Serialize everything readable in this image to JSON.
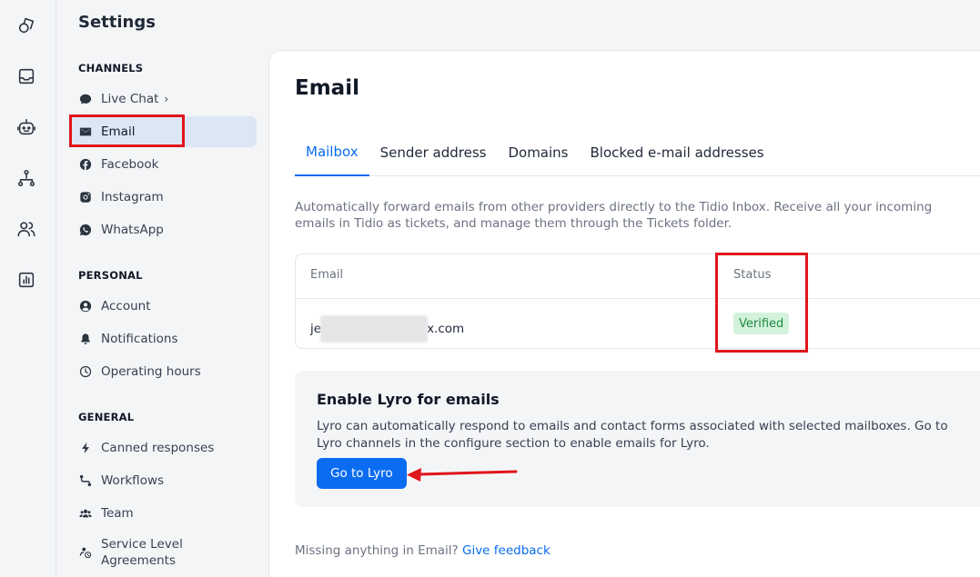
{
  "sidebar": {
    "title": "Settings",
    "sections": {
      "channels": "CHANNELS",
      "personal": "PERSONAL",
      "general": "GENERAL"
    },
    "items": {
      "live_chat": "Live Chat",
      "email": "Email",
      "facebook": "Facebook",
      "instagram": "Instagram",
      "whatsapp": "WhatsApp",
      "account": "Account",
      "notifications": "Notifications",
      "operating_hours": "Operating hours",
      "canned_responses": "Canned responses",
      "workflows": "Workflows",
      "team": "Team",
      "sla_line1": "Service Level",
      "sla_line2": "Agreements"
    }
  },
  "main": {
    "title": "Email",
    "tabs": [
      "Mailbox",
      "Sender address",
      "Domains",
      "Blocked e-mail addresses"
    ],
    "active_tab": "Mailbox",
    "description": "Automatically forward emails from other providers directly to the Tidio Inbox. Receive all your incoming emails in Tidio as tickets, and manage them through the Tickets folder.",
    "table": {
      "headers": {
        "email": "Email",
        "status": "Status"
      },
      "rows": [
        {
          "email_prefix": "je",
          "email_suffix": "x.com",
          "status": "Verified"
        }
      ]
    },
    "lyro": {
      "title": "Enable Lyro for emails",
      "description": "Lyro can automatically respond to emails and contact forms associated with selected mailboxes. Go to Lyro channels in the configure section to enable emails for Lyro.",
      "button": "Go to Lyro"
    },
    "footer": {
      "text": "Missing anything in Email?",
      "link": "Give feedback"
    }
  },
  "colors": {
    "accent": "#0a6cf0",
    "verified_bg": "#d3f2dc",
    "verified_text": "#1f8a43",
    "annotation_red": "#e0151b",
    "active_item_bg": "#dde6f5"
  },
  "icons": {
    "rail": [
      "shapes-icon",
      "inbox-icon",
      "bot-icon",
      "flow-icon",
      "users-icon",
      "analytics-icon"
    ]
  }
}
